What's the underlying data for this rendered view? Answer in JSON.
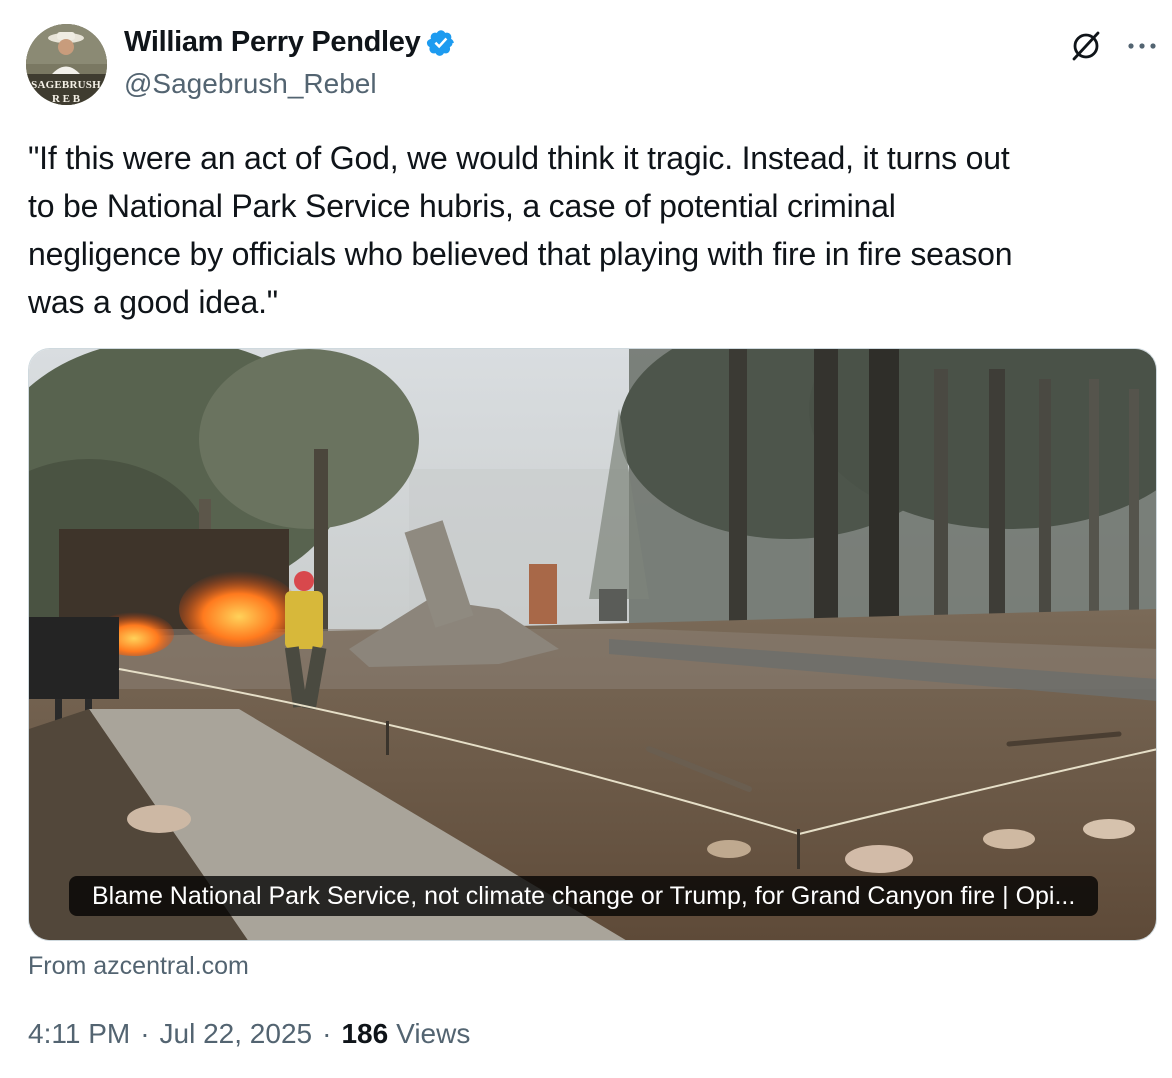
{
  "author": {
    "display_name": "William Perry Pendley",
    "handle": "@Sagebrush_Rebel",
    "verified": true,
    "avatar_text": "SAGEBRUSH"
  },
  "tweet": {
    "text": "\"If this were an act of God, we would think it tragic. Instead, it turns out\nto be National Park Service hubris, a case of potential criminal\nnegligence by officials who believed that playing with fire in fire season\nwas a good idea.\""
  },
  "card": {
    "title": "Blame National Park Service, not climate change or Trump, for Grand Canyon fire | Opi...",
    "source": "From azcentral.com"
  },
  "meta": {
    "time": "4:11 PM",
    "date": "Jul 22, 2025",
    "separator": "·",
    "views_count": "186",
    "views_label": "Views"
  },
  "icons": {
    "verified": "verified-badge-icon",
    "grok": "grok-icon",
    "more": "more-options-icon"
  },
  "colors": {
    "text_primary": "#0f1419",
    "text_secondary": "#536471",
    "verified_blue": "#1d9bf0"
  }
}
